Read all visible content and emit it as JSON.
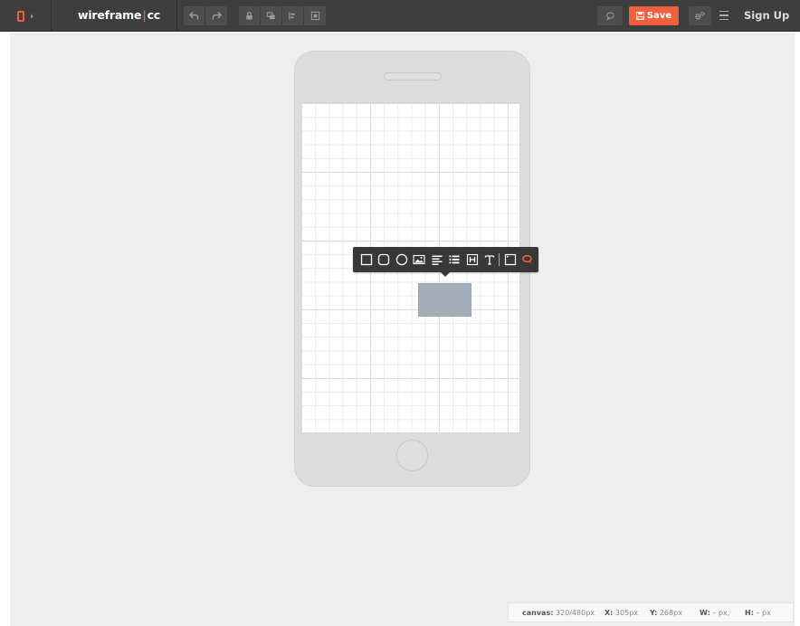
{
  "app": {
    "brand": {
      "left": "wireframe",
      "pipe": "|",
      "right": "cc"
    },
    "accent_color": "#f0603f",
    "topbar_color": "#3e3e3e"
  },
  "toolbar": {
    "device_icon": "phone-icon",
    "history": [
      {
        "name": "undo",
        "icon": "undo-icon"
      },
      {
        "name": "redo",
        "icon": "redo-icon"
      }
    ],
    "tools": [
      {
        "name": "lock",
        "icon": "lock-icon"
      },
      {
        "name": "bring-forward",
        "icon": "layers-icon"
      },
      {
        "name": "align",
        "icon": "align-left-icon"
      },
      {
        "name": "center",
        "icon": "center-icon"
      }
    ],
    "save_label": "Save",
    "signup_label": "Sign Up"
  },
  "element_popup": {
    "items": [
      {
        "name": "rectangle",
        "icon": "square-icon"
      },
      {
        "name": "rounded-rectangle",
        "icon": "rounded-square-icon"
      },
      {
        "name": "circle",
        "icon": "circle-icon"
      },
      {
        "name": "image",
        "icon": "image-icon"
      },
      {
        "name": "paragraph",
        "icon": "paragraph-icon"
      },
      {
        "name": "list",
        "icon": "list-icon"
      },
      {
        "name": "heading",
        "icon": "heading-icon"
      },
      {
        "name": "text",
        "icon": "text-icon"
      },
      {
        "name": "browser-box",
        "icon": "browser-box-icon"
      },
      {
        "name": "comment",
        "icon": "comment-icon"
      }
    ]
  },
  "status": {
    "canvas_label": "canvas:",
    "canvas_value": "320/480px",
    "x_label": "X:",
    "x_value": "305px",
    "y_label": "Y:",
    "y_value": "268px",
    "w_label": "W:",
    "w_value": "– px,",
    "h_label": "H:",
    "h_value": "– px"
  }
}
